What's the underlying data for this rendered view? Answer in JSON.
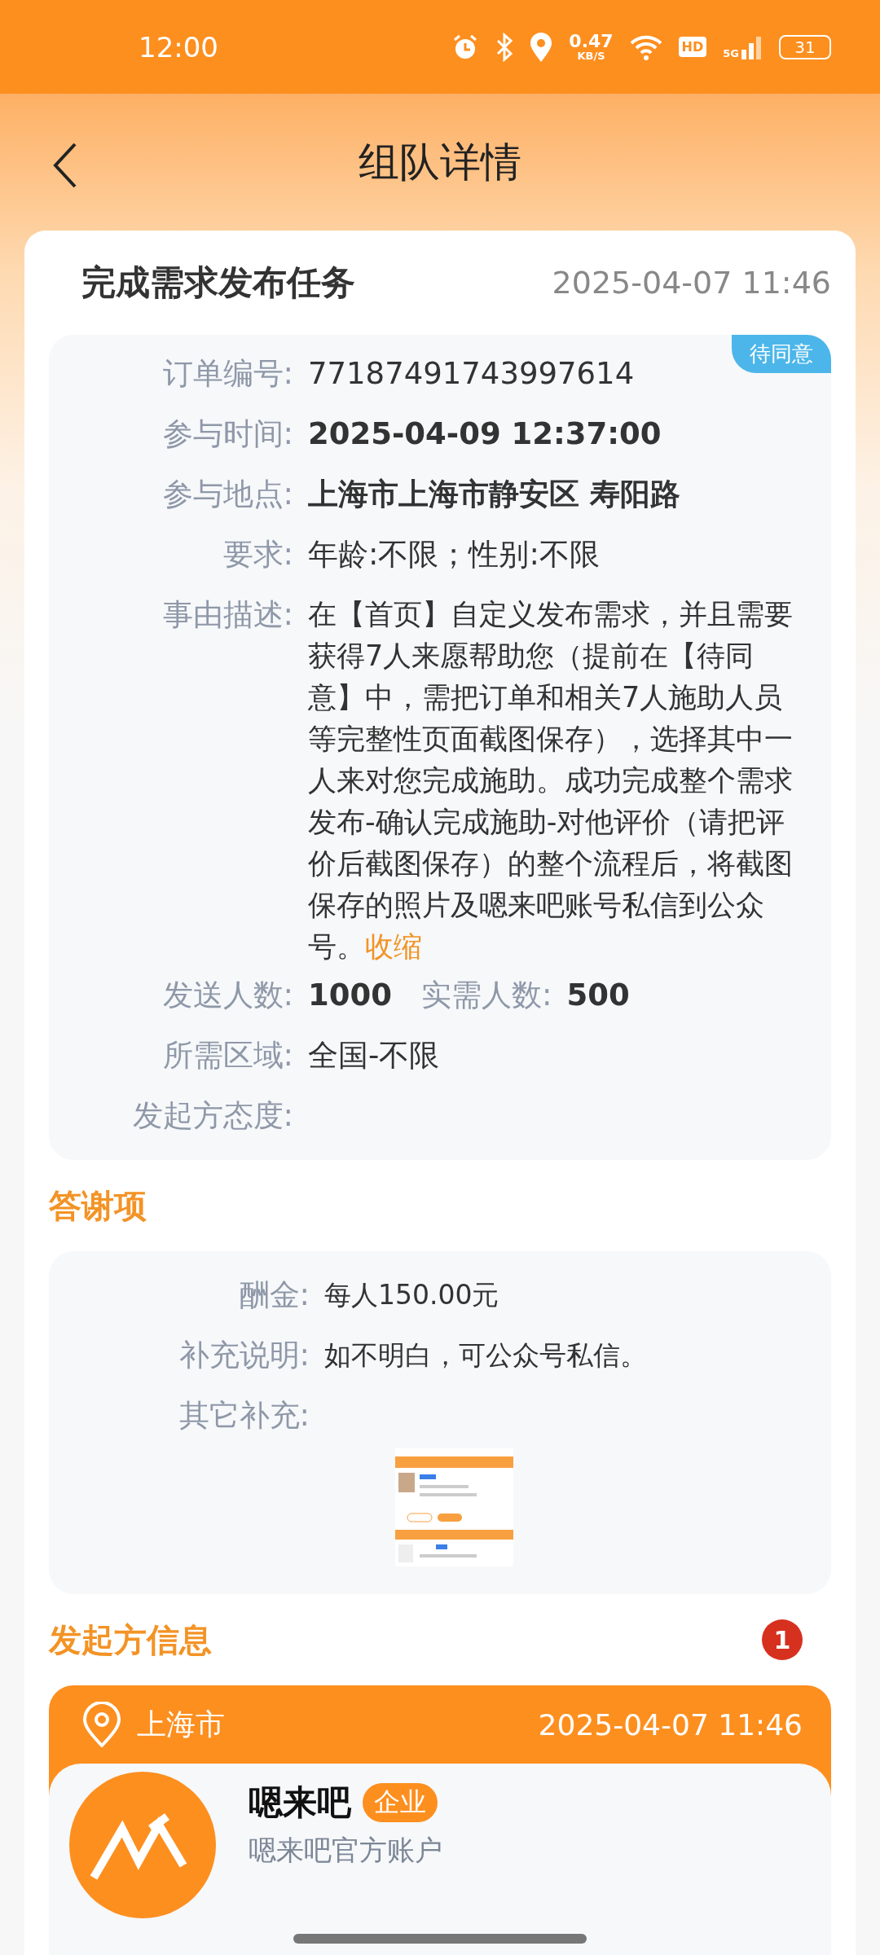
{
  "status_bar": {
    "time": "12:00",
    "speed_value": "0.47",
    "speed_unit": "KB/S",
    "hd": "HD",
    "network": "5G",
    "battery": "31"
  },
  "header": {
    "title": "组队详情"
  },
  "task": {
    "title": "完成需求发布任务",
    "date": "2025-04-07 11:46",
    "status": "待同意",
    "fields": [
      {
        "label": "订单编号:",
        "value": "77187491743997614",
        "bold": false
      },
      {
        "label": "参与时间:",
        "value": "2025-04-09 12:37:00",
        "bold": true
      },
      {
        "label": "参与地点:",
        "value": "上海市上海市静安区 寿阳路",
        "bold": true
      },
      {
        "label": "要求:",
        "value": "年龄:不限；性别:不限",
        "bold": false
      }
    ],
    "description": {
      "label": "事由描述:",
      "text": "在【首页】自定义发布需求，并且需要获得7人来愿帮助您（提前在【待同意】中，需把订单和相关7人施助人员等完整性页面截图保存），选择其中一人来对您完成施助。成功完成整个需求发布-确认完成施助-对他评价（请把评价后截图保存）的整个流程后，将截图保存的照片及嗯来吧账号私信到公众号。",
      "link": "收缩"
    },
    "counts": {
      "send_label": "发送人数:",
      "send_value": "1000",
      "need_label": "实需人数:",
      "need_value": "500"
    },
    "region": {
      "label": "所需区域:",
      "value": "全国-不限"
    },
    "attitude": {
      "label": "发起方态度:"
    }
  },
  "reward": {
    "heading": "答谢项",
    "fields": [
      {
        "label": "酬金:",
        "value": "每人150.00元"
      },
      {
        "label": "补充说明:",
        "value": "如不明白，可公众号私信。"
      }
    ],
    "other_label": "其它补充:"
  },
  "initiator": {
    "heading": "发起方信息",
    "badge": "1",
    "city": "上海市",
    "date": "2025-04-07 11:46",
    "name": "嗯来吧",
    "tag": "企业",
    "subtitle": "嗯来吧官方账户"
  }
}
